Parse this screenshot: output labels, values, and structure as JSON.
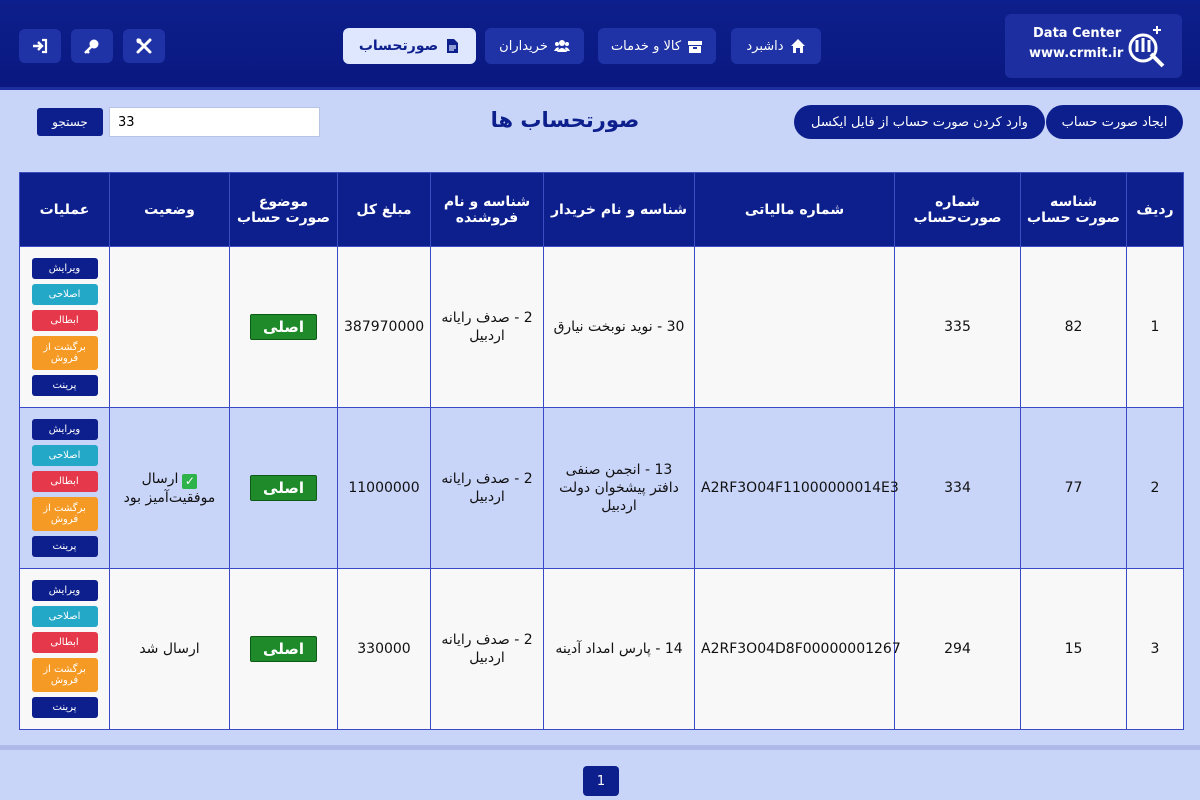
{
  "brand": {
    "title": "Data Center",
    "url": "www.crmit.ir"
  },
  "nav": [
    {
      "label": "داشبرد",
      "icon": "home-icon"
    },
    {
      "label": "کالا و خدمات",
      "icon": "box-icon"
    },
    {
      "label": "خریداران",
      "icon": "users-icon"
    },
    {
      "label": "صورتحساب",
      "icon": "invoice-icon",
      "active": true
    }
  ],
  "header_icons": [
    "tools-icon",
    "key-icon",
    "logout-icon"
  ],
  "toolbar": {
    "create_label": "ایجاد صورت حساب",
    "import_label": "وارد کردن صورت حساب از فایل ایکسل",
    "page_title": "صورتحساب ها",
    "search_value": "33",
    "search_button": "جستجو"
  },
  "table": {
    "headers": [
      "ردیف",
      "شناسه صورت حساب",
      "شماره صورت‌حساب",
      "شماره مالیاتی",
      "شناسه و نام خریدار",
      "شناسه و نام فروشنده",
      "مبلغ کل",
      "موضوع صورت حساب",
      "وضعیت",
      "عملیات"
    ],
    "rows": [
      {
        "row": "1",
        "id": "82",
        "number": "335",
        "tax": "",
        "buyer": "30 - نوید نوبخت نیارق",
        "seller": "2 - صدف رایانه اردبیل",
        "amount": "387970000",
        "subject": "اصلی",
        "status": ""
      },
      {
        "row": "2",
        "id": "77",
        "number": "334",
        "tax": "A2RF3O04F11000000014E3",
        "buyer": "13 - انجمن صنفی دافتر پیشخوان دولت اردبیل",
        "seller": "2 - صدف رایانه اردبیل",
        "amount": "11000000",
        "subject": "اصلی",
        "status": "ارسال موفقیت‌آمیز بود"
      },
      {
        "row": "3",
        "id": "15",
        "number": "294",
        "tax": "A2RF3O04D8F00000001267",
        "buyer": "14 - پارس امداد آدینه",
        "seller": "2 - صدف رایانه اردبیل",
        "amount": "330000",
        "subject": "اصلی",
        "status": "ارسال شد"
      }
    ],
    "actions": {
      "edit": "ویرایش",
      "fix": "اصلاحی",
      "cancel": "ابطالی",
      "return": "برگشت از فروش",
      "print": "پرینت"
    },
    "status_check": "✓"
  },
  "pagination": {
    "current": "1"
  },
  "colors": {
    "primary": "#0d1f8c",
    "background": "#c8d4f8",
    "success": "#1e8a2a",
    "danger": "#e5384b",
    "info": "#23a8c8",
    "warning": "#f59a25"
  }
}
